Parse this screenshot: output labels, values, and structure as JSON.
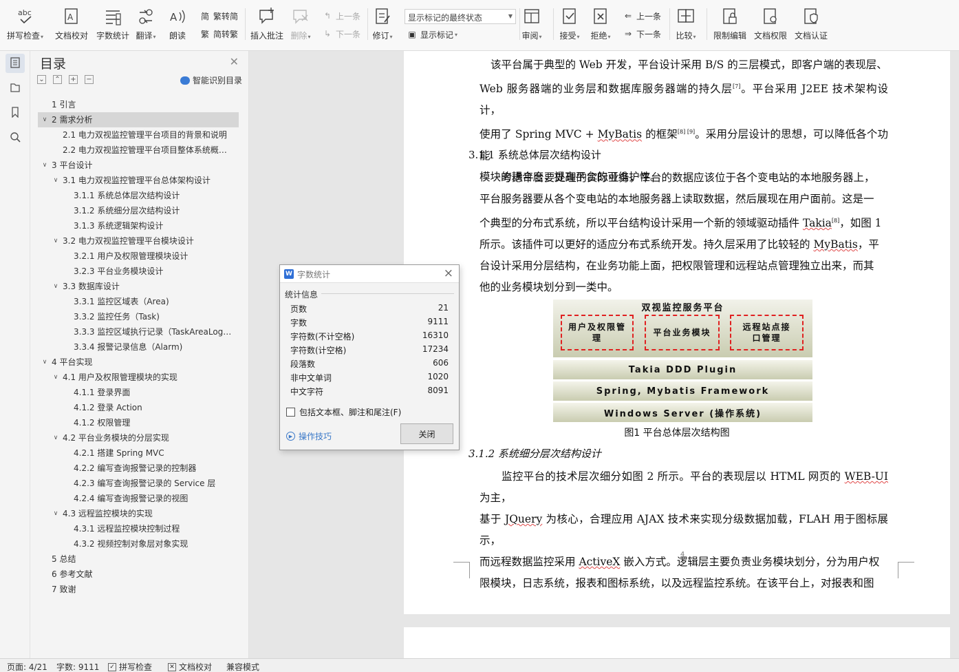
{
  "ribbon": {
    "spellcheck": "拼写检查",
    "doc_proof": "文档校对",
    "word_count": "字数统计",
    "translate": "翻译",
    "read_aloud": "朗读",
    "trad_to_simp": "繁转简",
    "simp_to_trad": "简转繁",
    "insert_comment": "插入批注",
    "delete": "删除",
    "prev_comment": "上一条",
    "next_comment": "下一条",
    "revise": "修订",
    "markup_state": "显示标记的最终状态",
    "show_markup": "显示标记",
    "review": "审阅",
    "accept": "接受",
    "reject": "拒绝",
    "prev_change": "上一条",
    "next_change": "下一条",
    "compare": "比较",
    "restrict_edit": "限制编辑",
    "doc_permission": "文档权限",
    "doc_certify": "文档认证"
  },
  "toc": {
    "title": "目录",
    "smart_label": "智能识别目录",
    "items": [
      {
        "text": "1  引言",
        "level": 1,
        "toggle": ""
      },
      {
        "text": "2  需求分析",
        "level": 1,
        "toggle": "∨",
        "selected": true
      },
      {
        "text": "2.1  电力双视监控管理平台项目的背景和说明",
        "level": 2,
        "toggle": ""
      },
      {
        "text": "2.2  电力双视监控管理平台项目整体系统概…",
        "level": 2,
        "toggle": ""
      },
      {
        "text": "3  平台设计",
        "level": 1,
        "toggle": "∨"
      },
      {
        "text": "3.1  电力双视监控管理平台总体架构设计",
        "level": 2,
        "toggle": "∨"
      },
      {
        "text": "3.1.1  系统总体层次结构设计",
        "level": 3,
        "toggle": ""
      },
      {
        "text": "3.1.2 系统细分层次结构设计",
        "level": 3,
        "toggle": ""
      },
      {
        "text": "3.1.3  系统逻辑架构设计",
        "level": 3,
        "toggle": ""
      },
      {
        "text": "3.2  电力双视监控管理平台模块设计",
        "level": 2,
        "toggle": "∨"
      },
      {
        "text": "3.2.1  用户及权限管理模块设计",
        "level": 3,
        "toggle": ""
      },
      {
        "text": "3.2.3  平台业务模块设计",
        "level": 3,
        "toggle": ""
      },
      {
        "text": "3.3  数据库设计",
        "level": 2,
        "toggle": "∨"
      },
      {
        "text": "3.3.1  监控区域表（Area)",
        "level": 3,
        "toggle": ""
      },
      {
        "text": "3.3.2  监控任务（Task)",
        "level": 3,
        "toggle": ""
      },
      {
        "text": "3.3.3  监控区域执行记录（TaskAreaLog…",
        "level": 3,
        "toggle": ""
      },
      {
        "text": "3.3.4  报警记录信息（Alarm)",
        "level": 3,
        "toggle": ""
      },
      {
        "text": "4  平台实现",
        "level": 1,
        "toggle": "∨"
      },
      {
        "text": "4.1 用户及权限管理模块的实现",
        "level": 2,
        "toggle": "∨"
      },
      {
        "text": "4.1.1  登录界面",
        "level": 3,
        "toggle": ""
      },
      {
        "text": "4.1.2 登录 Action",
        "level": 3,
        "toggle": ""
      },
      {
        "text": "4.1.2  权限管理",
        "level": 3,
        "toggle": ""
      },
      {
        "text": "4.2  平台业务模块的分层实现",
        "level": 2,
        "toggle": "∨"
      },
      {
        "text": "4.2.1  搭建 Spring MVC",
        "level": 3,
        "toggle": ""
      },
      {
        "text": "4.2.2  编写查询报警记录的控制器",
        "level": 3,
        "toggle": ""
      },
      {
        "text": "4.2.3  编写查询报警记录的 Service 层",
        "level": 3,
        "toggle": ""
      },
      {
        "text": "4.2.4  编写查询报警记录的视图",
        "level": 3,
        "toggle": ""
      },
      {
        "text": "4.3  远程监控模块的实现",
        "level": 2,
        "toggle": "∨"
      },
      {
        "text": "4.3.1  远程监控模块控制过程",
        "level": 3,
        "toggle": ""
      },
      {
        "text": "4.3.2  视频控制对象层对象实现",
        "level": 3,
        "toggle": ""
      },
      {
        "text": "5  总结",
        "level": 1,
        "toggle": ""
      },
      {
        "text": "6  参考文献",
        "level": 1,
        "toggle": ""
      },
      {
        "text": "7  致谢",
        "level": 1,
        "toggle": ""
      }
    ]
  },
  "dialog": {
    "title": "字数统计",
    "section": "统计信息",
    "stats": [
      {
        "label": "页数",
        "value": "21"
      },
      {
        "label": "字数",
        "value": "9111"
      },
      {
        "label": "字符数(不计空格)",
        "value": "16310"
      },
      {
        "label": "字符数(计空格)",
        "value": "17234"
      },
      {
        "label": "段落数",
        "value": "606"
      },
      {
        "label": "非中文单词",
        "value": "1020"
      },
      {
        "label": "中文字符",
        "value": "8091"
      }
    ],
    "checkbox_label": "包括文本框、脚注和尾注(F)",
    "tips_label": "操作技巧",
    "close_button": "关闭"
  },
  "document": {
    "para1": [
      "该平台属于典型的 Web 开发，平台设计采用 B/S 的三层模式，即客户端的表现层、",
      "Web 服务器端的业务层和数据库服务器端的持久层",
      "[7]",
      "。平台采用 J2EE 技术架构设计，",
      "使用了 Spring MVC + ",
      "MyBatis",
      " 的框架",
      "[8] [9]",
      "。采用分层设计的思想，可以降低各个功能",
      "模块的耦合度，提高平台的可维护性。"
    ],
    "heading1": "3.1.1  系统总体层次结构设计",
    "para2": [
      "考虑平台要处理的实际业务，平台的数据应该位于各个变电站的本地服务器上，",
      "平台服务器要从各个变电站的本地服务器上读取数据，然后展现在用户面前。这是一",
      "个典型的分布式系统，所以平台结构设计采用一个新的领域驱动插件 ",
      "Takia",
      "[8]",
      "，如图 1",
      "所示。该插件可以更好的适应分布式系统开发。持久层采用了比较轻的 ",
      "MyBatis",
      "，平",
      "台设计采用分层结构，在业务功能上面，把权限管理和远程站点管理独立出来，而其",
      "他的业务模块划分到一类中。"
    ],
    "figure": {
      "top_title": "双视监控服务平台",
      "box1": "用户及权限管理",
      "box2": "平台业务模块",
      "box3": "远程站点接口管理",
      "layer1": "Takia DDD Plugin",
      "layer2": "Spring, Mybatis Framework",
      "layer3": "Windows Server (操作系统)",
      "caption": "图1  平台总体层次结构图"
    },
    "heading2": "3.1.2 系统细分层次结构设计",
    "para3": [
      "监控平台的技术层次细分如图 2 所示。平台的表现层以 HTML 网页的 ",
      "WEB-UI",
      " 为主，",
      "基于 ",
      "JQuery",
      " 为核心，合理应用 AJAX 技术来实现分级数据加载，FLAH 用于图标展示，",
      "而远程数据监控采用 ",
      "ActiveX",
      " 嵌入方式。逻辑层主要负责业务模块划分，分为用户权",
      "限模块，日志系统，报表和图标系统，以及远程监控系统。在该平台上，对报表和图"
    ],
    "page_number": "4"
  },
  "status": {
    "page": "页面: 4/21",
    "words": "字数: 9111",
    "spell": "拼写检查",
    "proof": "文档校对",
    "compat": "兼容模式"
  }
}
